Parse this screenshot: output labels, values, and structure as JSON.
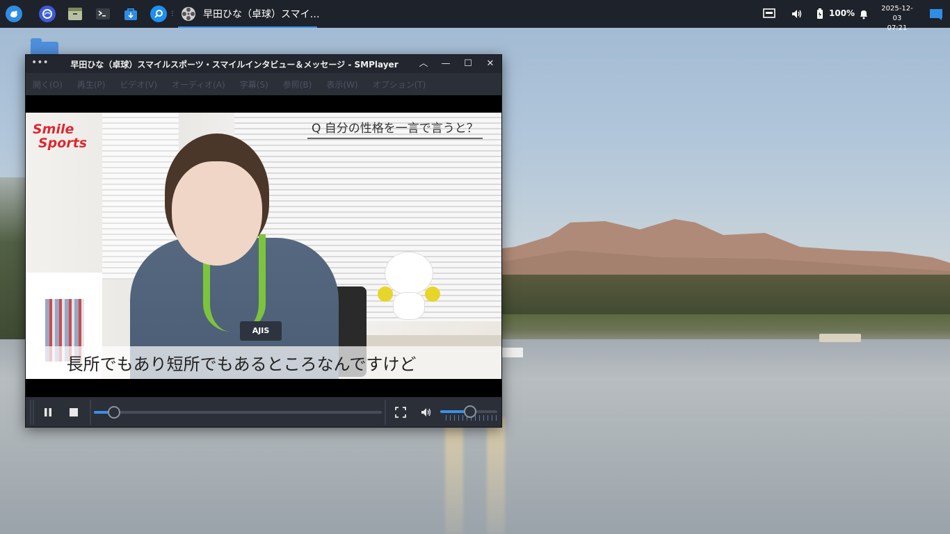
{
  "taskbar": {
    "launchers": [
      "app-launcher-icon",
      "browser-icon",
      "files-icon",
      "terminal-icon",
      "store-icon",
      "search-icon"
    ],
    "active_task_title": "早田ひな（卓球）スマイ…",
    "tray": {
      "battery_label": "100%",
      "date": "2025-12-03",
      "time": "07:21"
    }
  },
  "window": {
    "title": "早田ひな（卓球）スマイルスポーツ・スマイルインタビュー＆メッセージ  -  SMPlayer",
    "menu_button": "•••",
    "controls": {
      "shade": "︿",
      "minimize": "—",
      "maximize": "☐",
      "close": "✕"
    },
    "menu": [
      "開く(O)",
      "再生(P)",
      "ビデオ(V)",
      "オーディオ(A)",
      "字幕(S)",
      "参照(B)",
      "表示(W)",
      "オプション(T)"
    ]
  },
  "video": {
    "logo_line1": "Smile",
    "logo_line2": "Sports",
    "question": "Q 自分の性格を一言で言うと？",
    "badge": "AJIS",
    "subtitle": "長所でもあり短所でもあるところなんですけど"
  },
  "playback": {
    "seek_fraction": 0.07,
    "volume_fraction": 0.52
  },
  "colors": {
    "accent": "#3d8ee6",
    "panel": "#1e222a",
    "window_bg": "#2b2f38",
    "logo_red": "#e0262d"
  }
}
